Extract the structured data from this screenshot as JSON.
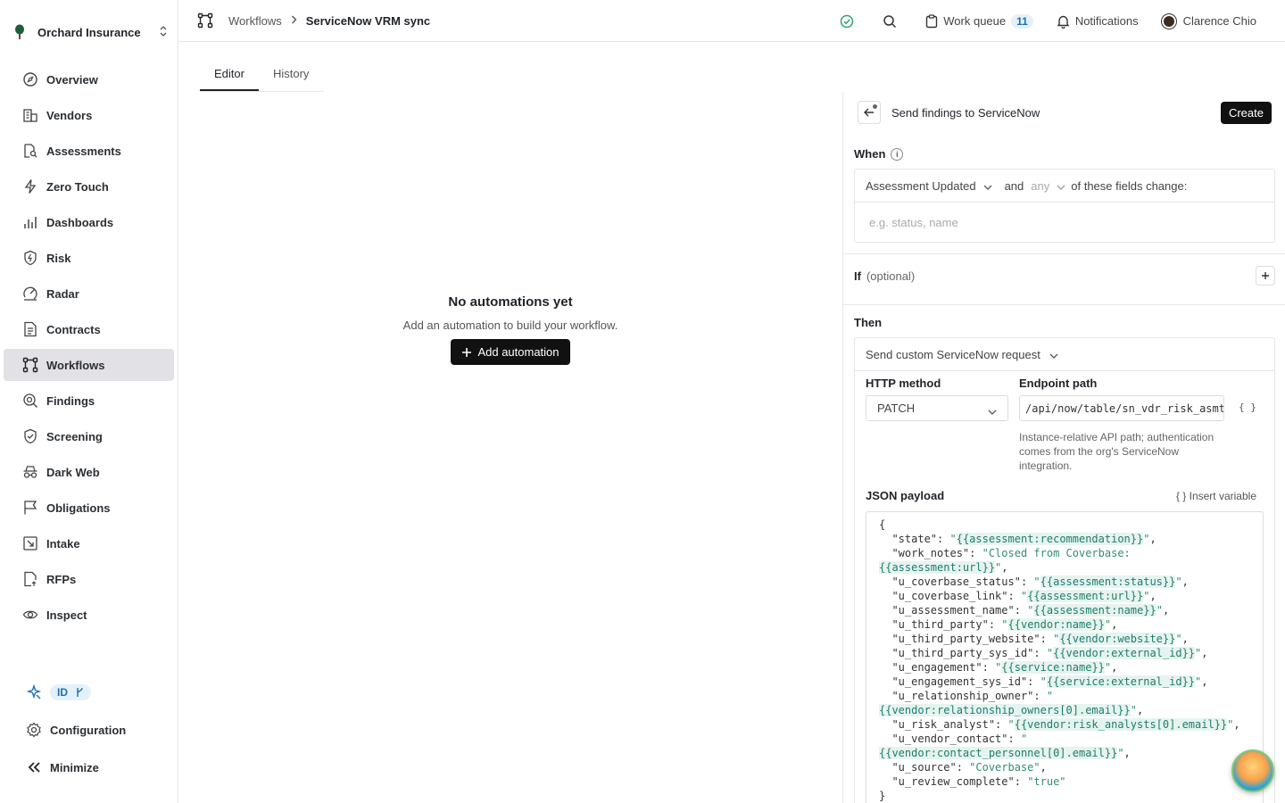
{
  "org": {
    "name": "Orchard Insurance"
  },
  "nav": [
    {
      "label": "Overview",
      "icon": "compass-icon"
    },
    {
      "label": "Vendors",
      "icon": "building-icon"
    },
    {
      "label": "Assessments",
      "icon": "doc-search-icon"
    },
    {
      "label": "Zero Touch",
      "icon": "bolt-icon"
    },
    {
      "label": "Dashboards",
      "icon": "bar-chart-icon"
    },
    {
      "label": "Risk",
      "icon": "shield-bolt-icon"
    },
    {
      "label": "Radar",
      "icon": "radar-icon"
    },
    {
      "label": "Contracts",
      "icon": "contract-icon"
    },
    {
      "label": "Workflows",
      "icon": "workflow-icon",
      "active": true
    },
    {
      "label": "Findings",
      "icon": "findings-icon"
    },
    {
      "label": "Screening",
      "icon": "shield-check-icon"
    },
    {
      "label": "Dark Web",
      "icon": "spy-icon"
    },
    {
      "label": "Obligations",
      "icon": "flag-icon"
    },
    {
      "label": "Intake",
      "icon": "intake-icon"
    },
    {
      "label": "RFPs",
      "icon": "rfp-icon"
    },
    {
      "label": "Inspect",
      "icon": "eye-icon"
    }
  ],
  "sidebar_bottom": {
    "badge_text": "ID",
    "config_label": "Configuration",
    "minimize_label": "Minimize"
  },
  "header": {
    "crumb_root": "Workflows",
    "crumb_current": "ServiceNow VRM sync",
    "work_queue_label": "Work queue",
    "work_queue_count": "11",
    "notifications_label": "Notifications",
    "user_name": "Clarence Chio"
  },
  "tabs": {
    "editor": "Editor",
    "history": "History"
  },
  "empty": {
    "title": "No automations yet",
    "subtitle": "Add an automation to build your workflow.",
    "button": "Add automation"
  },
  "panel": {
    "title": "Send findings to ServiceNow",
    "create_label": "Create",
    "when_label": "When",
    "trigger": "Assessment Updated",
    "and_text": "and",
    "any_text": "any",
    "fields_text": "of these fields change:",
    "fields_placeholder": "e.g. status, name",
    "if_label": "If",
    "if_optional": "(optional)",
    "then_label": "Then",
    "action": "Send custom ServiceNow request",
    "http_method_label": "HTTP method",
    "http_method_value": "PATCH",
    "endpoint_label": "Endpoint path",
    "endpoint_value": "/api/now/table/sn_vdr_risk_asmt",
    "endpoint_help": "Instance-relative API path; authentication comes from the org's ServiceNow integration.",
    "json_label": "JSON payload",
    "insert_variable": "{ } Insert variable"
  },
  "json_lines": [
    [
      [
        "p",
        "{"
      ]
    ],
    [
      [
        "p",
        "  "
      ],
      [
        "k",
        "\"state\""
      ],
      [
        "p",
        ": "
      ],
      [
        "s",
        "\""
      ],
      [
        "v",
        "{{assessment:recommendation}}"
      ],
      [
        "s",
        "\""
      ],
      [
        "p",
        ","
      ]
    ],
    [
      [
        "p",
        "  "
      ],
      [
        "k",
        "\"work_notes\""
      ],
      [
        "p",
        ": "
      ],
      [
        "s",
        "\"Closed from Coverbase:"
      ]
    ],
    [
      [
        "v",
        "{{assessment:url}}"
      ],
      [
        "s",
        "\""
      ],
      [
        "p",
        ","
      ]
    ],
    [
      [
        "p",
        "  "
      ],
      [
        "k",
        "\"u_coverbase_status\""
      ],
      [
        "p",
        ": "
      ],
      [
        "s",
        "\""
      ],
      [
        "v",
        "{{assessment:status}}"
      ],
      [
        "s",
        "\""
      ],
      [
        "p",
        ","
      ]
    ],
    [
      [
        "p",
        "  "
      ],
      [
        "k",
        "\"u_coverbase_link\""
      ],
      [
        "p",
        ": "
      ],
      [
        "s",
        "\""
      ],
      [
        "v",
        "{{assessment:url}}"
      ],
      [
        "s",
        "\""
      ],
      [
        "p",
        ","
      ]
    ],
    [
      [
        "p",
        "  "
      ],
      [
        "k",
        "\"u_assessment_name\""
      ],
      [
        "p",
        ": "
      ],
      [
        "s",
        "\""
      ],
      [
        "v",
        "{{assessment:name}}"
      ],
      [
        "s",
        "\""
      ],
      [
        "p",
        ","
      ]
    ],
    [
      [
        "p",
        "  "
      ],
      [
        "k",
        "\"u_third_party\""
      ],
      [
        "p",
        ": "
      ],
      [
        "s",
        "\""
      ],
      [
        "v",
        "{{vendor:name}}"
      ],
      [
        "s",
        "\""
      ],
      [
        "p",
        ","
      ]
    ],
    [
      [
        "p",
        "  "
      ],
      [
        "k",
        "\"u_third_party_website\""
      ],
      [
        "p",
        ": "
      ],
      [
        "s",
        "\""
      ],
      [
        "v",
        "{{vendor:website}}"
      ],
      [
        "s",
        "\""
      ],
      [
        "p",
        ","
      ]
    ],
    [
      [
        "p",
        "  "
      ],
      [
        "k",
        "\"u_third_party_sys_id\""
      ],
      [
        "p",
        ": "
      ],
      [
        "s",
        "\""
      ],
      [
        "v",
        "{{vendor:external_id}}"
      ],
      [
        "s",
        "\""
      ],
      [
        "p",
        ","
      ]
    ],
    [
      [
        "p",
        "  "
      ],
      [
        "k",
        "\"u_engagement\""
      ],
      [
        "p",
        ": "
      ],
      [
        "s",
        "\""
      ],
      [
        "v",
        "{{service:name}}"
      ],
      [
        "s",
        "\""
      ],
      [
        "p",
        ","
      ]
    ],
    [
      [
        "p",
        "  "
      ],
      [
        "k",
        "\"u_engagement_sys_id\""
      ],
      [
        "p",
        ": "
      ],
      [
        "s",
        "\""
      ],
      [
        "v",
        "{{service:external_id}}"
      ],
      [
        "s",
        "\""
      ],
      [
        "p",
        ","
      ]
    ],
    [
      [
        "p",
        "  "
      ],
      [
        "k",
        "\"u_relationship_owner\""
      ],
      [
        "p",
        ": "
      ],
      [
        "s",
        "\""
      ]
    ],
    [
      [
        "v",
        "{{vendor:relationship_owners[0].email}}"
      ],
      [
        "s",
        "\""
      ],
      [
        "p",
        ","
      ]
    ],
    [
      [
        "p",
        "  "
      ],
      [
        "k",
        "\"u_risk_analyst\""
      ],
      [
        "p",
        ": "
      ],
      [
        "s",
        "\""
      ],
      [
        "v",
        "{{vendor:risk_analysts[0].email}}"
      ],
      [
        "s",
        "\""
      ],
      [
        "p",
        ","
      ]
    ],
    [
      [
        "p",
        "  "
      ],
      [
        "k",
        "\"u_vendor_contact\""
      ],
      [
        "p",
        ": "
      ],
      [
        "s",
        "\""
      ]
    ],
    [
      [
        "v",
        "{{vendor:contact_personnel[0].email}}"
      ],
      [
        "s",
        "\""
      ],
      [
        "p",
        ","
      ]
    ],
    [
      [
        "p",
        "  "
      ],
      [
        "k",
        "\"u_source\""
      ],
      [
        "p",
        ": "
      ],
      [
        "s",
        "\"Coverbase\""
      ],
      [
        "p",
        ","
      ]
    ],
    [
      [
        "p",
        "  "
      ],
      [
        "k",
        "\"u_review_complete\""
      ],
      [
        "p",
        ": "
      ],
      [
        "s",
        "\"true\""
      ]
    ],
    [
      [
        "p",
        "}"
      ]
    ]
  ]
}
